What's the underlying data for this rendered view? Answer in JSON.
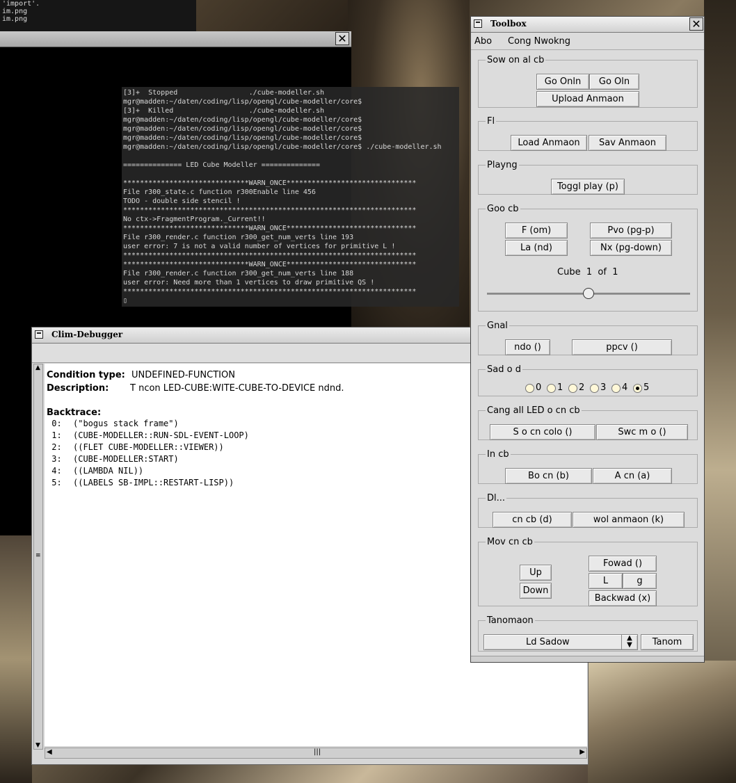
{
  "desktop": {
    "top_lines": [
      "'import'.",
      "im.png",
      "im.png"
    ]
  },
  "terminal": {
    "lines": [
      "[3]+  Stopped                 ./cube-modeller.sh",
      "mgr@madden:~/daten/coding/lisp/opengl/cube-modeller/core$",
      "[3]+  Killed                  ./cube-modeller.sh",
      "mgr@madden:~/daten/coding/lisp/opengl/cube-modeller/core$",
      "mgr@madden:~/daten/coding/lisp/opengl/cube-modeller/core$",
      "mgr@madden:~/daten/coding/lisp/opengl/cube-modeller/core$",
      "mgr@madden:~/daten/coding/lisp/opengl/cube-modeller/core$ ./cube-modeller.sh",
      "",
      "============== LED Cube Modeller ==============",
      "",
      "******************************WARN_ONCE*******************************",
      "File r300_state.c function r300Enable line 456",
      "TODO - double side stencil !",
      "**********************************************************************",
      "No ctx->FragmentProgram._Current!!",
      "******************************WARN_ONCE*******************************",
      "File r300_render.c function r300_get_num_verts line 193",
      "user error: 7 is not a valid number of vertices for primitive L !",
      "**********************************************************************",
      "******************************WARN_ONCE*******************************",
      "File r300_render.c function r300_get_num_verts line 188",
      "user error: Need more than 1 vertices to draw primitive QS !",
      "**********************************************************************",
      "▯"
    ]
  },
  "debugger": {
    "title": "Clim-Debugger",
    "condition_label": "Condition type:",
    "condition_value": "UNDEFINED-FUNCTION",
    "description_label": "Description:",
    "description_value": "T ncon LED-CUBE:WITE-CUBE-TO-DEVICE  ndnd.",
    "backtrace_label": "Backtrace:",
    "frames": [
      {
        "num": " 0:",
        "text": "(\"bogus stack frame\")"
      },
      {
        "num": " 1:",
        "text": "(CUBE-MODELLER::RUN-SDL-EVENT-LOOP)"
      },
      {
        "num": " 2:",
        "text": "((FLET CUBE-MODELLER::VIEWER))"
      },
      {
        "num": " 3:",
        "text": "(CUBE-MODELLER:START)"
      },
      {
        "num": " 4:",
        "text": "((LAMBDA NIL))"
      },
      {
        "num": " 5:",
        "text": "((LABELS SB-IMPL::RESTART-LISP))"
      }
    ]
  },
  "toolbox": {
    "title": "Toolbox",
    "menu": [
      "Abo",
      "Cong Nwokng"
    ],
    "show_cube": {
      "legend": "Sow on  al cb",
      "go_online": "Go Onln",
      "go_offline": "Go Oln",
      "upload": "Upload Anmaon"
    },
    "file": {
      "legend": "Fl",
      "load": "Load Anmaon",
      "save": "Sav Anmaon"
    },
    "playing": {
      "legend": "Playng",
      "toggle": "Toggl play (p)"
    },
    "goto_cube": {
      "legend": "Goo cb",
      "first": "F (om)",
      "prev": "Pvo (pg-p)",
      "last": "La (nd)",
      "next": "Nx (pg-down)",
      "counter_word": "Cube",
      "current": "1",
      "of_word": "of",
      "total": "1",
      "slider_value": 0.5
    },
    "general": {
      "legend": "Gnal",
      "undo": "ndo ()",
      "prev": "ppcv ()"
    },
    "shadow": {
      "legend": "Sad o d",
      "options": [
        "0",
        "1",
        "2",
        "3",
        "4",
        "5"
      ],
      "selected": "5"
    },
    "change_all": {
      "legend": "Cang all LED o  cn cb",
      "show_color": "S o cn colo ()",
      "switch_mode": "Swc m o ()"
    },
    "insert_cube": {
      "legend": "In cb",
      "before": "Bo cn (b)",
      "after": "A cn (a)"
    },
    "delete": {
      "legend": "Dl...",
      "cube": "cn cb (d)",
      "whole": "wol anmaon (k)"
    },
    "move": {
      "legend": "Mov  cn cb",
      "up": "Up",
      "down": "Down",
      "forward": "Fowad ()",
      "left": "L",
      "right": "g",
      "backward": "Backwad (x)"
    },
    "transformation": {
      "legend": "Tanomaon",
      "select_value": "Ld Sadow",
      "transform": "Tanom"
    }
  }
}
